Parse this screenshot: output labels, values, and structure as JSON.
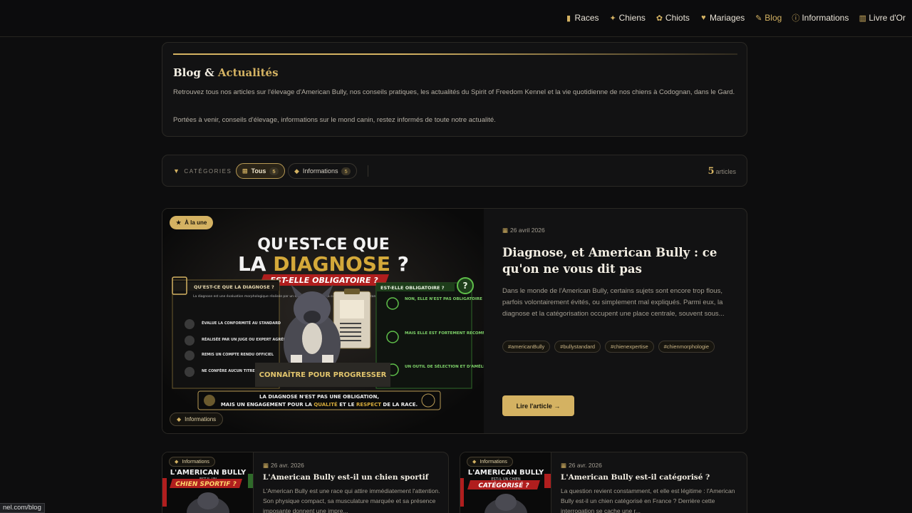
{
  "nav": [
    {
      "label": "Races",
      "icon": "document-icon",
      "glyph": "▮"
    },
    {
      "label": "Chiens",
      "icon": "dog-icon",
      "glyph": "✦"
    },
    {
      "label": "Chiots",
      "icon": "paw-icon",
      "glyph": "✿"
    },
    {
      "label": "Mariages",
      "icon": "heart-icon",
      "glyph": "♥"
    },
    {
      "label": "Blog",
      "icon": "blog-icon",
      "glyph": "✎"
    },
    {
      "label": "Informations",
      "icon": "info-icon",
      "glyph": "ⓘ"
    },
    {
      "label": "Livre d'Or",
      "icon": "book-icon",
      "glyph": "▥"
    }
  ],
  "intro": {
    "title_plain": "Blog &",
    "title_accent": "Actualités",
    "paragraph1": "Retrouvez tous nos articles sur l'élevage d'American Bully, nos conseils pratiques, les actualités du Spirit of Freedom Kennel et la vie quotidienne de nos chiens à Codognan, dans le Gard.",
    "paragraph2": "Portées à venir, conseils d'élevage, informations sur le mond canin, restez informés de toute notre actualité."
  },
  "filters": {
    "label": "CATÉGORIES",
    "chips": [
      {
        "label": "Tous",
        "count": "5",
        "active": true
      },
      {
        "label": "Informations",
        "count": "5",
        "active": false
      }
    ],
    "article_count": "5",
    "article_word": "articles"
  },
  "featured": {
    "badge": "À la une",
    "category": "Informations",
    "date": "26 avril 2026",
    "title": "Diagnose, et American Bully : ce qu'on ne vous dit pas",
    "excerpt": "Dans le monde de l'American Bully, certains sujets sont encore trop flous, parfois volontairement évités, ou simplement mal expliqués. Parmi eux, la diagnose et la catégorisation occupent une place centrale, souvent sous...",
    "tags": [
      "#americanBully",
      "#bullystandard",
      "#chienexpertise",
      "#chienmorphologie"
    ],
    "read_more": "Lire l'article →",
    "image": {
      "headline1": "QU'EST-CE QUE",
      "headline2a": "LA ",
      "headline2b": "DIAGNOSE",
      "headline2c": " ?",
      "ribbon": "EST-ELLE OBLIGATOIRE ?",
      "left_head": "QU'EST-CE QUE LA DIAGNOSE ?",
      "left_desc": "La diagnose est une évaluation morphologique réalisée par un expert pour vérifier la conformité du chien au standard de la race.",
      "left_items": [
        "ÉVALUE LA CONFORMITÉ AU STANDARD",
        "RÉALISÉE PAR UN JUGE OU EXPERT AGRÉÉ",
        "REMIS UN COMPTE RENDU OFFICIEL",
        "NE CONFÈRE AUCUN TITRE, MAIS APPORTE UNE VALEUR AJOUTÉE"
      ],
      "right_head": "EST-ELLE OBLIGATOIRE ?",
      "right_items": [
        "NON, ELLE N'EST PAS OBLIGATOIRE",
        "MAIS ELLE EST FORTEMENT RECOMMANDÉE",
        "UN OUTIL DE SÉLECTION ET D'AMÉLIORATION"
      ],
      "pedestal": "CONNAÎTRE POUR PROGRESSER",
      "footer1": "LA DIAGNOSE N'EST PAS UNE OBLIGATION,",
      "footer2a": "MAIS UN ENGAGEMENT POUR LA ",
      "footer2b": "QUALITÉ",
      "footer2c": " ET LE ",
      "footer2d": "RESPECT",
      "footer2e": " DE LA RACE."
    }
  },
  "articles": [
    {
      "category": "Informations",
      "date": "26 avr. 2026",
      "title": "L'American Bully est-il un chien sportif",
      "excerpt": "L'American Bully est une race qui attire immédiatement l'attention. Son physique compact, sa musculature marquée et sa présence imposante donnent une impre...",
      "thumb_line1": "L'AMERICAN BULLY",
      "thumb_line2": "EST-IL UN",
      "thumb_line3": "CHIEN SPORTIF ?"
    },
    {
      "category": "Informations",
      "date": "26 avr. 2026",
      "title": "L'American Bully est-il catégorisé ?",
      "excerpt": "La question revient constamment, et elle est légitime : l'American Bully est-il un chien catégorisé en France ? Derrière cette interrogation se cache une r...",
      "thumb_line1": "L'AMERICAN BULLY",
      "thumb_line2": "EST-IL UN CHIEN",
      "thumb_line3": "CATÉGORISÉ ?"
    }
  ],
  "status_url": "nel.com/blog",
  "colors": {
    "accent": "#d4b262",
    "background": "#0d0d0e",
    "card": "#121213"
  }
}
